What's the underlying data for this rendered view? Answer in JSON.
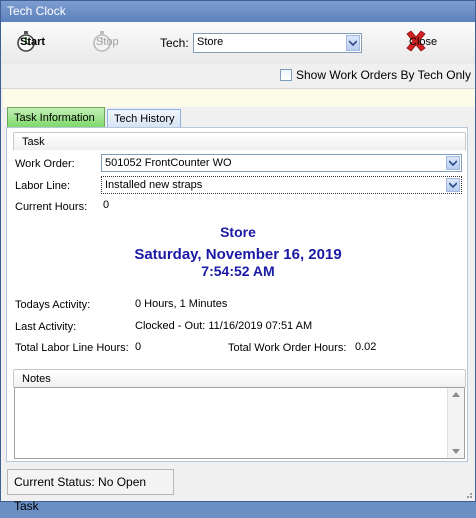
{
  "window": {
    "title": "Tech Clock"
  },
  "toolbar": {
    "start_label": "Start",
    "stop_label": "Stop",
    "tech_label": "Tech:",
    "tech_value": "Store",
    "close_label": "Close"
  },
  "options": {
    "show_by_tech_label": "Show Work Orders By Tech Only",
    "show_by_tech_checked": false
  },
  "tabs": [
    {
      "label": "Task Information",
      "active": true
    },
    {
      "label": "Tech History",
      "active": false
    }
  ],
  "task": {
    "group_label": "Task",
    "work_order_label": "Work Order:",
    "work_order_value": "501052 FrontCounter WO",
    "labor_line_label": "Labor Line:",
    "labor_line_value": "Installed new straps",
    "current_hours_label": "Current Hours:",
    "current_hours_value": "0"
  },
  "clock": {
    "tech_name": "Store",
    "date": "Saturday, November 16, 2019",
    "time": "7:54:52 AM"
  },
  "activity": {
    "todays_label": "Todays Activity:",
    "todays_value": "0 Hours, 1 Minutes",
    "last_label": "Last Activity:",
    "last_value": "Clocked - Out: 11/16/2019 07:51 AM",
    "labor_hours_label": "Total Labor Line Hours:",
    "labor_hours_value": "0",
    "wo_hours_label": "Total Work Order Hours:",
    "wo_hours_value": "0.02"
  },
  "notes": {
    "label": "Notes",
    "value": ""
  },
  "status": {
    "text": "Current Status: No Open Task"
  },
  "colors": {
    "accent_text": "#1a1aa6",
    "active_tab": "#7dd86a",
    "close_x": "#d42020"
  }
}
